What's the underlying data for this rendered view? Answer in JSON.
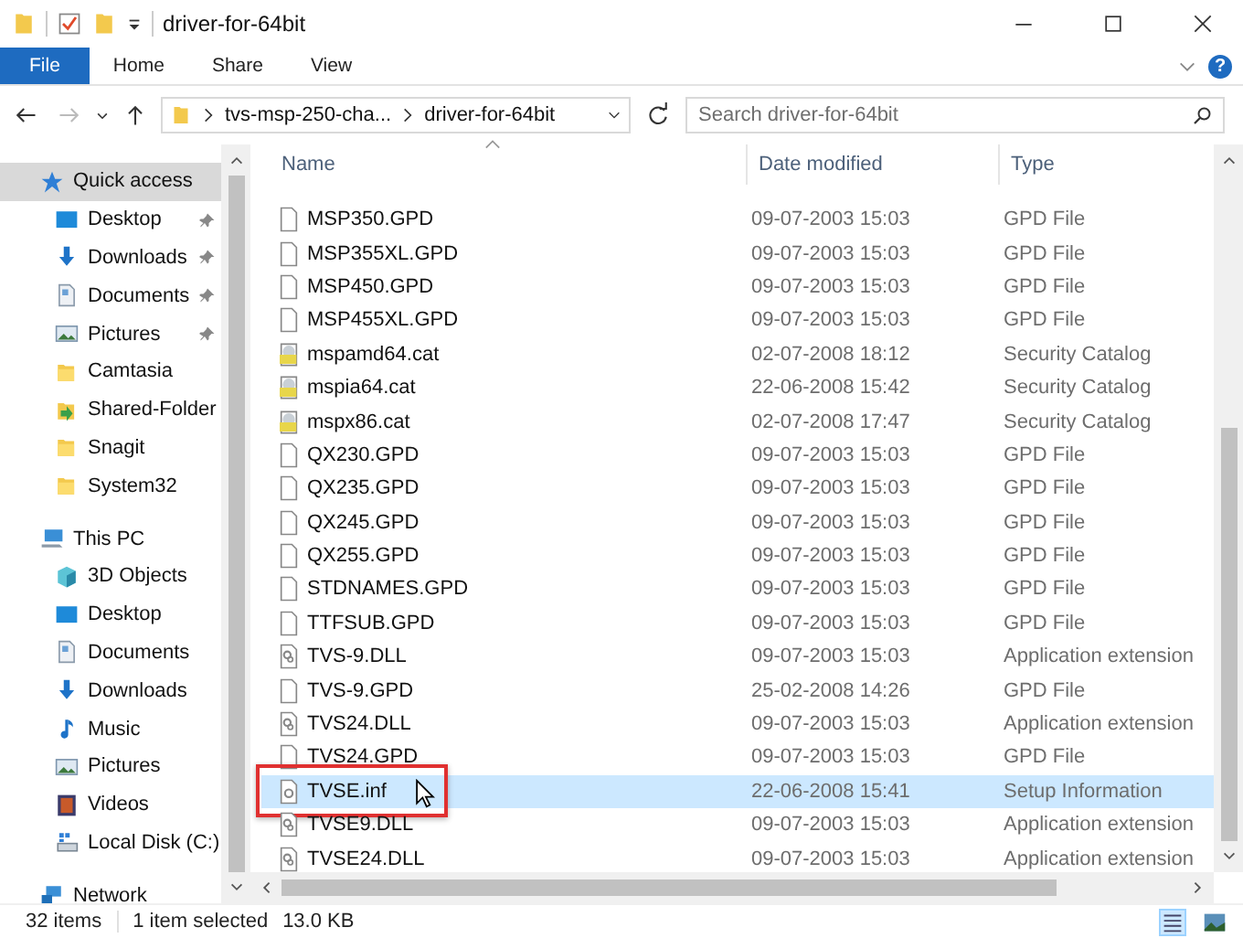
{
  "window": {
    "title": "driver-for-64bit"
  },
  "ribbon": {
    "tabs": [
      {
        "label": "File",
        "selected": true
      },
      {
        "label": "Home",
        "selected": false
      },
      {
        "label": "Share",
        "selected": false
      },
      {
        "label": "View",
        "selected": false
      }
    ],
    "help": "?"
  },
  "address": {
    "crumbs": [
      "tvs-msp-250-cha...",
      "driver-for-64bit"
    ],
    "search_placeholder": "Search driver-for-64bit"
  },
  "sidebar": [
    {
      "label": "Quick access",
      "kind": "star",
      "selected": true,
      "children": [
        {
          "label": "Desktop",
          "kind": "desktop",
          "pinned": true
        },
        {
          "label": "Downloads",
          "kind": "download",
          "pinned": true
        },
        {
          "label": "Documents",
          "kind": "document",
          "pinned": true
        },
        {
          "label": "Pictures",
          "kind": "pictures",
          "pinned": true
        },
        {
          "label": "Camtasia",
          "kind": "folder",
          "pinned": false
        },
        {
          "label": "Shared-Folder",
          "kind": "shared",
          "pinned": false
        },
        {
          "label": "Snagit",
          "kind": "folder",
          "pinned": false
        },
        {
          "label": "System32",
          "kind": "folder",
          "pinned": false
        }
      ]
    },
    {
      "label": "This PC",
      "kind": "pc",
      "selected": false,
      "children": [
        {
          "label": "3D Objects",
          "kind": "cube",
          "pinned": false
        },
        {
          "label": "Desktop",
          "kind": "desktop",
          "pinned": false
        },
        {
          "label": "Documents",
          "kind": "document",
          "pinned": false
        },
        {
          "label": "Downloads",
          "kind": "download",
          "pinned": false
        },
        {
          "label": "Music",
          "kind": "music",
          "pinned": false
        },
        {
          "label": "Pictures",
          "kind": "pictures",
          "pinned": false
        },
        {
          "label": "Videos",
          "kind": "videos",
          "pinned": false
        },
        {
          "label": "Local Disk (C:)",
          "kind": "disk",
          "pinned": false
        }
      ]
    },
    {
      "label": "Network",
      "kind": "network",
      "selected": false
    }
  ],
  "table": {
    "columns": [
      "Name",
      "Date modified",
      "Type"
    ],
    "rows": [
      {
        "name": "MSP350.GPD",
        "date": "09-07-2003 15:03",
        "type": "GPD File",
        "kind": "gpd",
        "selected": false
      },
      {
        "name": "MSP355XL.GPD",
        "date": "09-07-2003 15:03",
        "type": "GPD File",
        "kind": "gpd",
        "selected": false
      },
      {
        "name": "MSP450.GPD",
        "date": "09-07-2003 15:03",
        "type": "GPD File",
        "kind": "gpd",
        "selected": false
      },
      {
        "name": "MSP455XL.GPD",
        "date": "09-07-2003 15:03",
        "type": "GPD File",
        "kind": "gpd",
        "selected": false
      },
      {
        "name": "mspamd64.cat",
        "date": "02-07-2008 18:12",
        "type": "Security Catalog",
        "kind": "cat",
        "selected": false
      },
      {
        "name": "mspia64.cat",
        "date": "22-06-2008 15:42",
        "type": "Security Catalog",
        "kind": "cat",
        "selected": false
      },
      {
        "name": "mspx86.cat",
        "date": "02-07-2008 17:47",
        "type": "Security Catalog",
        "kind": "cat",
        "selected": false
      },
      {
        "name": "QX230.GPD",
        "date": "09-07-2003 15:03",
        "type": "GPD File",
        "kind": "gpd",
        "selected": false
      },
      {
        "name": "QX235.GPD",
        "date": "09-07-2003 15:03",
        "type": "GPD File",
        "kind": "gpd",
        "selected": false
      },
      {
        "name": "QX245.GPD",
        "date": "09-07-2003 15:03",
        "type": "GPD File",
        "kind": "gpd",
        "selected": false
      },
      {
        "name": "QX255.GPD",
        "date": "09-07-2003 15:03",
        "type": "GPD File",
        "kind": "gpd",
        "selected": false
      },
      {
        "name": "STDNAMES.GPD",
        "date": "09-07-2003 15:03",
        "type": "GPD File",
        "kind": "gpd",
        "selected": false
      },
      {
        "name": "TTFSUB.GPD",
        "date": "09-07-2003 15:03",
        "type": "GPD File",
        "kind": "gpd",
        "selected": false
      },
      {
        "name": "TVS-9.DLL",
        "date": "09-07-2003 15:03",
        "type": "Application extension",
        "kind": "dll",
        "selected": false
      },
      {
        "name": "TVS-9.GPD",
        "date": "25-02-2008 14:26",
        "type": "GPD File",
        "kind": "gpd",
        "selected": false
      },
      {
        "name": "TVS24.DLL",
        "date": "09-07-2003 15:03",
        "type": "Application extension",
        "kind": "dll",
        "selected": false
      },
      {
        "name": "TVS24.GPD",
        "date": "09-07-2003 15:03",
        "type": "GPD File",
        "kind": "gpd",
        "selected": false
      },
      {
        "name": "TVSE.inf",
        "date": "22-06-2008 15:41",
        "type": "Setup Information",
        "kind": "inf",
        "selected": true,
        "highlighted": true,
        "pointer": true
      },
      {
        "name": "TVSE9.DLL",
        "date": "09-07-2003 15:03",
        "type": "Application extension",
        "kind": "dll",
        "selected": false
      },
      {
        "name": "TVSE24.DLL",
        "date": "09-07-2003 15:03",
        "type": "Application extension",
        "kind": "dll",
        "selected": false
      }
    ]
  },
  "status_bar": {
    "count": "32 items",
    "selection": "1 item selected",
    "size": "13.0 KB",
    "views": [
      {
        "kind": "details",
        "selected": true
      },
      {
        "kind": "large-icons",
        "selected": false
      }
    ]
  }
}
